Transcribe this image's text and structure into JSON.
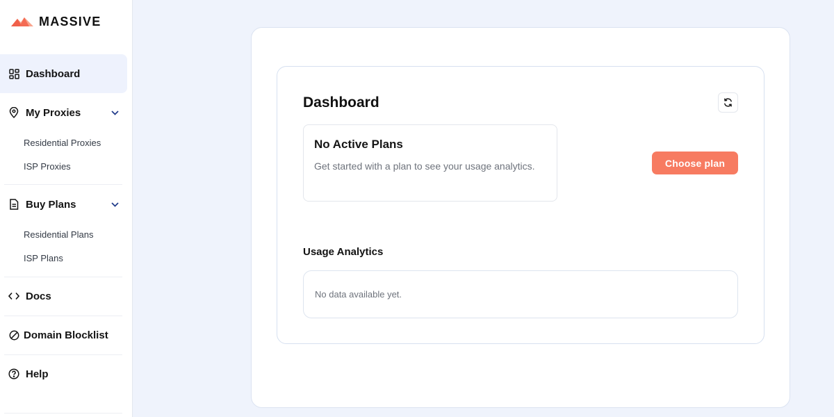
{
  "brand": {
    "name": "MASSIVE",
    "colors": {
      "accent": "#f77b61",
      "logo_dark": "#f0604a",
      "logo_light": "#f9a38c"
    }
  },
  "sidebar": {
    "dashboard": {
      "label": "Dashboard",
      "icon": "grid-icon"
    },
    "my_proxies": {
      "label": "My Proxies",
      "icon": "location-pin-icon",
      "items": [
        {
          "label": "Residential Proxies"
        },
        {
          "label": "ISP Proxies"
        }
      ]
    },
    "buy_plans": {
      "label": "Buy Plans",
      "icon": "document-icon",
      "items": [
        {
          "label": "Residential Plans"
        },
        {
          "label": "ISP Plans"
        }
      ]
    },
    "docs": {
      "label": "Docs",
      "icon": "code-icon"
    },
    "domain_blocklist": {
      "label": "Domain Blocklist",
      "icon": "blocked-icon"
    },
    "help": {
      "label": "Help",
      "icon": "question-circle-icon"
    }
  },
  "main": {
    "title": "Dashboard",
    "refresh_icon": "refresh-icon",
    "plans": {
      "title": "No Active Plans",
      "description": "Get started with a plan to see your usage analytics."
    },
    "choose_plan_label": "Choose plan",
    "analytics": {
      "title": "Usage Analytics",
      "empty_text": "No data available yet."
    }
  }
}
